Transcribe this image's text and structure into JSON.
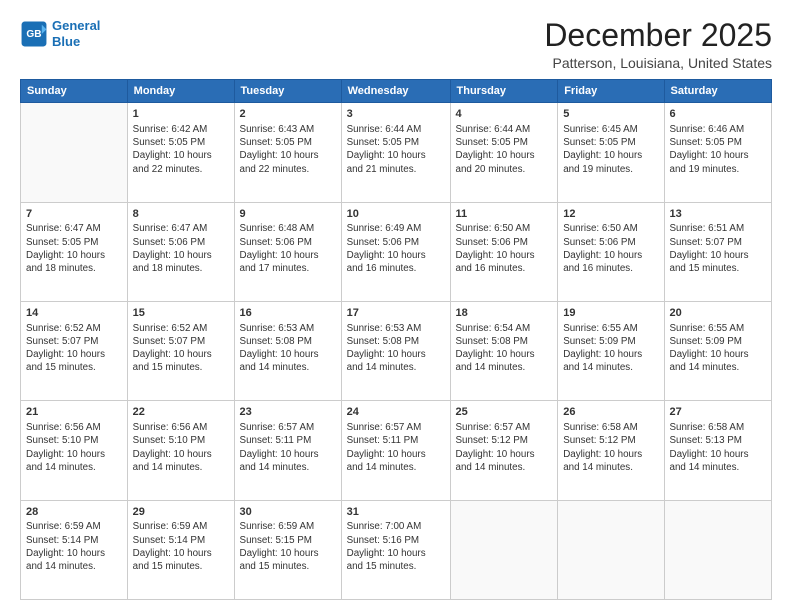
{
  "logo": {
    "line1": "General",
    "line2": "Blue"
  },
  "title": "December 2025",
  "subtitle": "Patterson, Louisiana, United States",
  "header_days": [
    "Sunday",
    "Monday",
    "Tuesday",
    "Wednesday",
    "Thursday",
    "Friday",
    "Saturday"
  ],
  "weeks": [
    [
      {
        "num": "",
        "info": ""
      },
      {
        "num": "1",
        "info": "Sunrise: 6:42 AM\nSunset: 5:05 PM\nDaylight: 10 hours\nand 22 minutes."
      },
      {
        "num": "2",
        "info": "Sunrise: 6:43 AM\nSunset: 5:05 PM\nDaylight: 10 hours\nand 22 minutes."
      },
      {
        "num": "3",
        "info": "Sunrise: 6:44 AM\nSunset: 5:05 PM\nDaylight: 10 hours\nand 21 minutes."
      },
      {
        "num": "4",
        "info": "Sunrise: 6:44 AM\nSunset: 5:05 PM\nDaylight: 10 hours\nand 20 minutes."
      },
      {
        "num": "5",
        "info": "Sunrise: 6:45 AM\nSunset: 5:05 PM\nDaylight: 10 hours\nand 19 minutes."
      },
      {
        "num": "6",
        "info": "Sunrise: 6:46 AM\nSunset: 5:05 PM\nDaylight: 10 hours\nand 19 minutes."
      }
    ],
    [
      {
        "num": "7",
        "info": "Sunrise: 6:47 AM\nSunset: 5:05 PM\nDaylight: 10 hours\nand 18 minutes."
      },
      {
        "num": "8",
        "info": "Sunrise: 6:47 AM\nSunset: 5:06 PM\nDaylight: 10 hours\nand 18 minutes."
      },
      {
        "num": "9",
        "info": "Sunrise: 6:48 AM\nSunset: 5:06 PM\nDaylight: 10 hours\nand 17 minutes."
      },
      {
        "num": "10",
        "info": "Sunrise: 6:49 AM\nSunset: 5:06 PM\nDaylight: 10 hours\nand 16 minutes."
      },
      {
        "num": "11",
        "info": "Sunrise: 6:50 AM\nSunset: 5:06 PM\nDaylight: 10 hours\nand 16 minutes."
      },
      {
        "num": "12",
        "info": "Sunrise: 6:50 AM\nSunset: 5:06 PM\nDaylight: 10 hours\nand 16 minutes."
      },
      {
        "num": "13",
        "info": "Sunrise: 6:51 AM\nSunset: 5:07 PM\nDaylight: 10 hours\nand 15 minutes."
      }
    ],
    [
      {
        "num": "14",
        "info": "Sunrise: 6:52 AM\nSunset: 5:07 PM\nDaylight: 10 hours\nand 15 minutes."
      },
      {
        "num": "15",
        "info": "Sunrise: 6:52 AM\nSunset: 5:07 PM\nDaylight: 10 hours\nand 15 minutes."
      },
      {
        "num": "16",
        "info": "Sunrise: 6:53 AM\nSunset: 5:08 PM\nDaylight: 10 hours\nand 14 minutes."
      },
      {
        "num": "17",
        "info": "Sunrise: 6:53 AM\nSunset: 5:08 PM\nDaylight: 10 hours\nand 14 minutes."
      },
      {
        "num": "18",
        "info": "Sunrise: 6:54 AM\nSunset: 5:08 PM\nDaylight: 10 hours\nand 14 minutes."
      },
      {
        "num": "19",
        "info": "Sunrise: 6:55 AM\nSunset: 5:09 PM\nDaylight: 10 hours\nand 14 minutes."
      },
      {
        "num": "20",
        "info": "Sunrise: 6:55 AM\nSunset: 5:09 PM\nDaylight: 10 hours\nand 14 minutes."
      }
    ],
    [
      {
        "num": "21",
        "info": "Sunrise: 6:56 AM\nSunset: 5:10 PM\nDaylight: 10 hours\nand 14 minutes."
      },
      {
        "num": "22",
        "info": "Sunrise: 6:56 AM\nSunset: 5:10 PM\nDaylight: 10 hours\nand 14 minutes."
      },
      {
        "num": "23",
        "info": "Sunrise: 6:57 AM\nSunset: 5:11 PM\nDaylight: 10 hours\nand 14 minutes."
      },
      {
        "num": "24",
        "info": "Sunrise: 6:57 AM\nSunset: 5:11 PM\nDaylight: 10 hours\nand 14 minutes."
      },
      {
        "num": "25",
        "info": "Sunrise: 6:57 AM\nSunset: 5:12 PM\nDaylight: 10 hours\nand 14 minutes."
      },
      {
        "num": "26",
        "info": "Sunrise: 6:58 AM\nSunset: 5:12 PM\nDaylight: 10 hours\nand 14 minutes."
      },
      {
        "num": "27",
        "info": "Sunrise: 6:58 AM\nSunset: 5:13 PM\nDaylight: 10 hours\nand 14 minutes."
      }
    ],
    [
      {
        "num": "28",
        "info": "Sunrise: 6:59 AM\nSunset: 5:14 PM\nDaylight: 10 hours\nand 14 minutes."
      },
      {
        "num": "29",
        "info": "Sunrise: 6:59 AM\nSunset: 5:14 PM\nDaylight: 10 hours\nand 15 minutes."
      },
      {
        "num": "30",
        "info": "Sunrise: 6:59 AM\nSunset: 5:15 PM\nDaylight: 10 hours\nand 15 minutes."
      },
      {
        "num": "31",
        "info": "Sunrise: 7:00 AM\nSunset: 5:16 PM\nDaylight: 10 hours\nand 15 minutes."
      },
      {
        "num": "",
        "info": ""
      },
      {
        "num": "",
        "info": ""
      },
      {
        "num": "",
        "info": ""
      }
    ]
  ]
}
